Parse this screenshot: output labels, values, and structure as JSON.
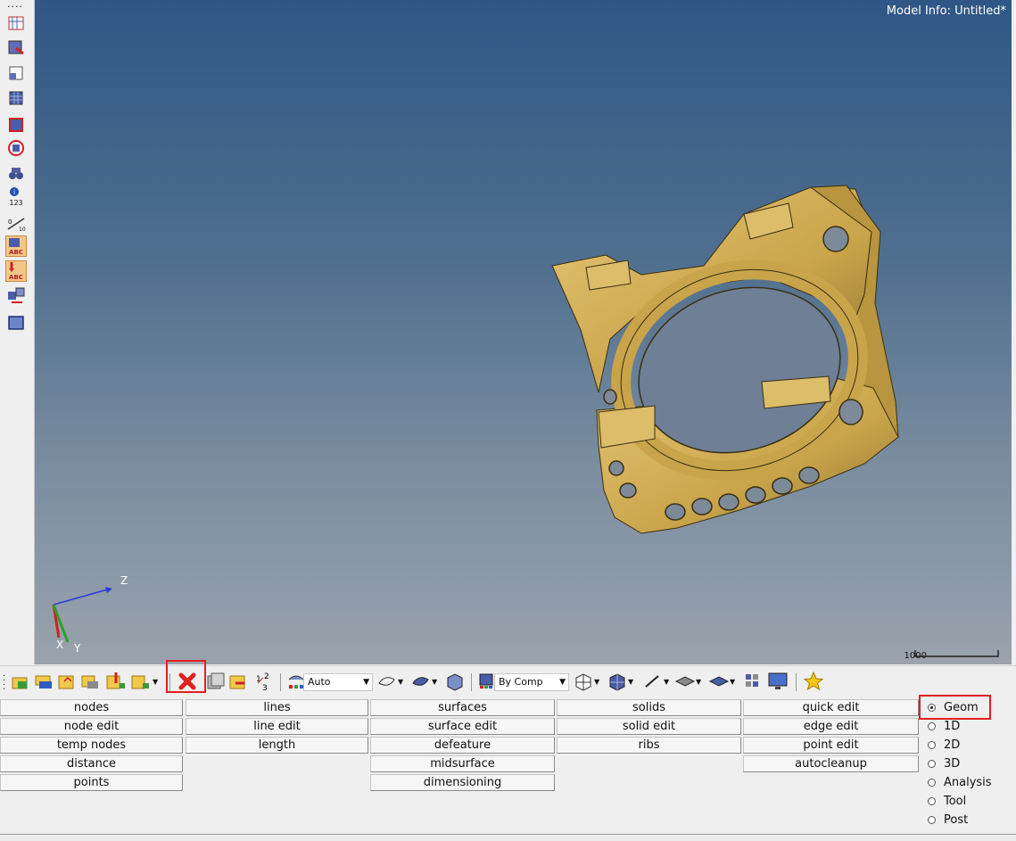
{
  "model_info": "Model Info: Untitled*",
  "scale": {
    "label": "1000"
  },
  "axes": {
    "z": "Z",
    "x": "X",
    "y": "Y"
  },
  "toolbar": {
    "auto_select": "Auto",
    "by_comp_select": "By Comp"
  },
  "left_toolbar_icons": [
    "dots-grip",
    "display-icon",
    "mask-icon",
    "find-icon",
    "mesh-icon",
    "reverse-icon",
    "circle-mark-icon",
    "binoculars-icon",
    "info-123-icon",
    "ruler-icon",
    "abc-label-icon",
    "abc-down-icon",
    "transform-icon",
    "window-icon"
  ],
  "panel": {
    "columns": [
      [
        "nodes",
        "node edit",
        "temp nodes",
        "distance",
        "points"
      ],
      [
        "lines",
        "line edit",
        "length"
      ],
      [
        "surfaces",
        "surface edit",
        "defeature",
        "midsurface",
        "dimensioning"
      ],
      [
        "solids",
        "solid edit",
        "ribs"
      ],
      [
        "quick edit",
        "edge edit",
        "point edit",
        "autocleanup"
      ]
    ],
    "radios": [
      "Geom",
      "1D",
      "2D",
      "3D",
      "Analysis",
      "Tool",
      "Post"
    ],
    "selected_radio": "Geom"
  },
  "colors": {
    "highlight": "#e02020",
    "model": "#d4b25a"
  }
}
